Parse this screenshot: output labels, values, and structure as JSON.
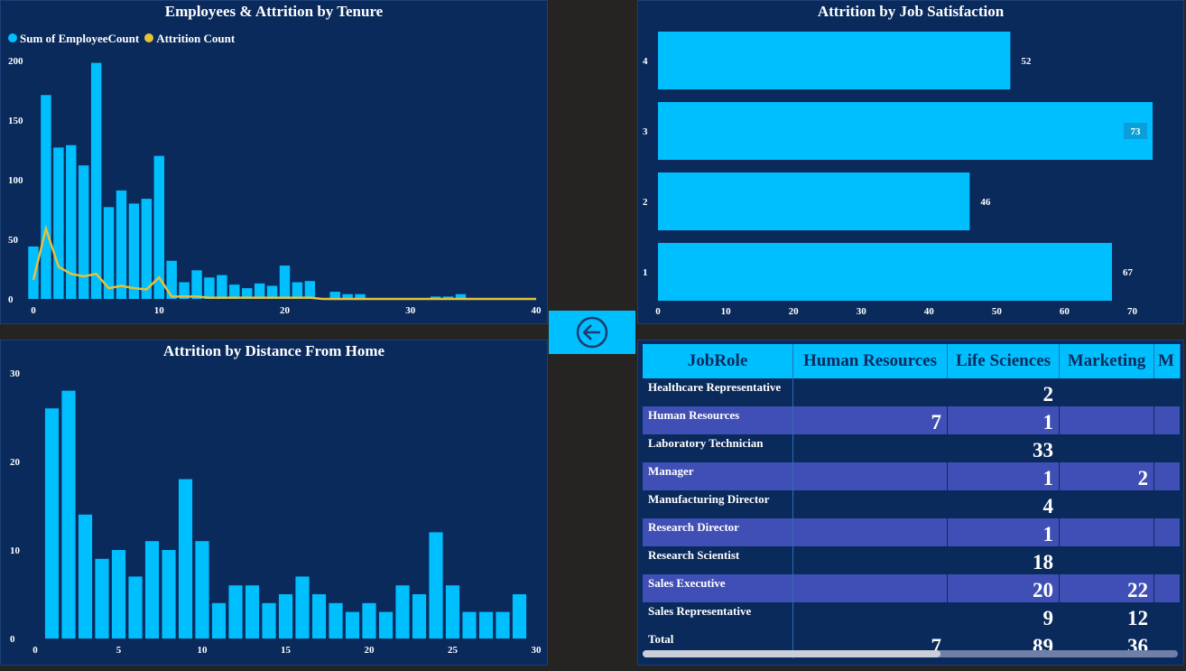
{
  "colors": {
    "bar": "#00bfff",
    "line": "#e6c13a",
    "panel": "#0a2a5c",
    "background": "#252423",
    "alt_row": "#3f4fb5"
  },
  "back_button": {
    "icon": "arrow-left-circle-icon"
  },
  "chart_data": [
    {
      "type": "bar",
      "title": "Employees & Attrition by Tenure",
      "series": [
        {
          "name": "Sum of EmployeeCount",
          "values": [
            44,
            171,
            127,
            129,
            112,
            198,
            77,
            91,
            80,
            84,
            120,
            32,
            14,
            24,
            18,
            20,
            12,
            9,
            13,
            11,
            28,
            14,
            15,
            0,
            6,
            4,
            4,
            0,
            0,
            0,
            0,
            0,
            2,
            2,
            4,
            0,
            0,
            0,
            0,
            0,
            0
          ]
        },
        {
          "name": "Attrition Count",
          "values": [
            16,
            59,
            27,
            21,
            19,
            21,
            9,
            11,
            9,
            8,
            18,
            2,
            2,
            2,
            1,
            1,
            1,
            1,
            1,
            1,
            1,
            1,
            1,
            0,
            0,
            0,
            0,
            0,
            0,
            0,
            0,
            0,
            0,
            0,
            0,
            0,
            0,
            0,
            0,
            0,
            0
          ]
        }
      ],
      "x": [
        0,
        1,
        2,
        3,
        4,
        5,
        6,
        7,
        8,
        9,
        10,
        11,
        12,
        13,
        14,
        15,
        16,
        17,
        18,
        19,
        20,
        21,
        22,
        23,
        24,
        25,
        26,
        27,
        28,
        29,
        30,
        31,
        32,
        33,
        34,
        35,
        36,
        37,
        38,
        39,
        40
      ],
      "xticks": [
        "0",
        "10",
        "20",
        "30",
        "40"
      ],
      "yticks": [
        "0",
        "50",
        "100",
        "150",
        "200"
      ],
      "ylim": [
        0,
        200
      ]
    },
    {
      "type": "bar",
      "orientation": "horizontal",
      "title": "Attrition by Job Satisfaction",
      "categories": [
        "4",
        "3",
        "2",
        "1"
      ],
      "values": [
        52,
        73,
        46,
        67
      ],
      "xticks": [
        "0",
        "10",
        "20",
        "30",
        "40",
        "50",
        "60",
        "70"
      ],
      "xlim": [
        0,
        73
      ]
    },
    {
      "type": "bar",
      "title": "Attrition by Distance From Home",
      "x": [
        1,
        2,
        3,
        4,
        5,
        6,
        7,
        8,
        9,
        10,
        11,
        12,
        13,
        14,
        15,
        16,
        17,
        18,
        19,
        20,
        21,
        22,
        23,
        24,
        25,
        26,
        27,
        28,
        29
      ],
      "values": [
        26,
        28,
        14,
        9,
        10,
        7,
        11,
        10,
        18,
        11,
        4,
        6,
        6,
        4,
        5,
        7,
        5,
        4,
        3,
        4,
        3,
        6,
        5,
        12,
        6,
        3,
        3,
        3,
        5
      ],
      "xticks": [
        "0",
        "5",
        "10",
        "15",
        "20",
        "25",
        "30"
      ],
      "yticks": [
        "0",
        "10",
        "20",
        "30"
      ],
      "ylim": [
        0,
        30
      ]
    }
  ],
  "matrix": {
    "columns": [
      "JobRole",
      "Human Resources",
      "Life Sciences",
      "Marketing",
      "M"
    ],
    "rows": [
      {
        "label": "Healthcare Representative",
        "values": [
          "",
          "2",
          "",
          ""
        ]
      },
      {
        "label": "Human Resources",
        "values": [
          "7",
          "1",
          "",
          ""
        ]
      },
      {
        "label": "Laboratory Technician",
        "values": [
          "",
          "33",
          "",
          ""
        ]
      },
      {
        "label": "Manager",
        "values": [
          "",
          "1",
          "2",
          ""
        ]
      },
      {
        "label": "Manufacturing Director",
        "values": [
          "",
          "4",
          "",
          ""
        ]
      },
      {
        "label": "Research Director",
        "values": [
          "",
          "1",
          "",
          ""
        ]
      },
      {
        "label": "Research Scientist",
        "values": [
          "",
          "18",
          "",
          ""
        ]
      },
      {
        "label": "Sales Executive",
        "values": [
          "",
          "20",
          "22",
          ""
        ]
      },
      {
        "label": "Sales Representative",
        "values": [
          "",
          "9",
          "12",
          ""
        ]
      }
    ],
    "total": {
      "label": "Total",
      "values": [
        "7",
        "89",
        "36",
        ""
      ]
    }
  }
}
